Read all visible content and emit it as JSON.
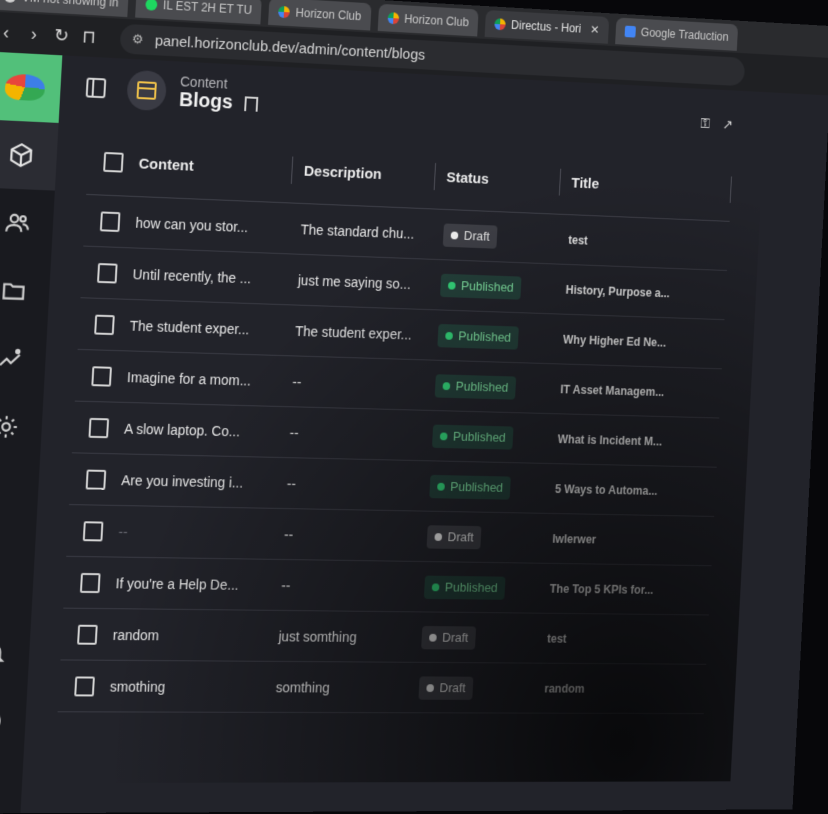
{
  "browser": {
    "tabs": [
      {
        "label": "VM not showing in",
        "icon": "vm-icon",
        "active": false
      },
      {
        "label": "IL EST 2H ET TU",
        "icon": "spotify-icon",
        "active": false
      },
      {
        "label": "Horizon Club",
        "icon": "horizon-icon",
        "active": false
      },
      {
        "label": "Horizon Club",
        "icon": "horizon-icon",
        "active": false
      },
      {
        "label": "Directus - Hori",
        "icon": "horizon-icon",
        "active": true
      },
      {
        "label": "Google Traduction",
        "icon": "google-translate-icon",
        "active": false
      }
    ],
    "url": "panel.horizonclub.dev/admin/content/blogs"
  },
  "header": {
    "breadcrumb": "Content",
    "title": "Blogs"
  },
  "table": {
    "columns": [
      "Content",
      "Description",
      "Status",
      "Title"
    ],
    "rows": [
      {
        "content": "how can you stor...",
        "description": "The standard chu...",
        "status": "Draft",
        "title": "test"
      },
      {
        "content": "Until recently, the ...",
        "description": "just me saying so...",
        "status": "Published",
        "title": "History, Purpose a..."
      },
      {
        "content": "The student exper...",
        "description": "The student exper...",
        "status": "Published",
        "title": "Why Higher Ed Ne..."
      },
      {
        "content": "Imagine for a mom...",
        "description": "--",
        "status": "Published",
        "title": "IT Asset Managem..."
      },
      {
        "content": "A slow laptop. Co...",
        "description": "--",
        "status": "Published",
        "title": "What is Incident M..."
      },
      {
        "content": "Are you investing i...",
        "description": "--",
        "status": "Published",
        "title": "5 Ways to Automa..."
      },
      {
        "content": "--",
        "description": "--",
        "status": "Draft",
        "title": "lwlerwer"
      },
      {
        "content": "If you're a Help De...",
        "description": "--",
        "status": "Published",
        "title": "The Top 5 KPIs for..."
      },
      {
        "content": "random",
        "description": "just somthing",
        "status": "Draft",
        "title": "test"
      },
      {
        "content": "smothing",
        "description": "somthing",
        "status": "Draft",
        "title": "random"
      }
    ]
  },
  "colors": {
    "accent": "#52c07a",
    "draft_badge": "#3e3f46",
    "published_badge": "#24403a",
    "published_dot": "#34d47a"
  }
}
